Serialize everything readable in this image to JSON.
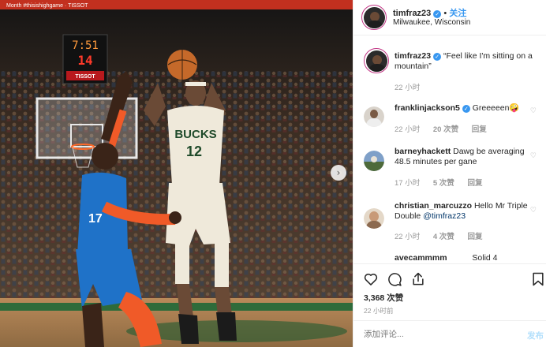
{
  "header": {
    "username": "timfraz23",
    "verified_icon": "verified-badge-icon",
    "separator": "•",
    "follow_label": "关注",
    "location": "Milwaukee, Wisconsin"
  },
  "photo": {
    "scoreboard_time": "7:51",
    "shot_clock": "14",
    "sponsor": "TISSOT",
    "jersey_team": "BUCKS",
    "jersey_number": "12",
    "opponent_number": "17",
    "banner_text": "Month  #thisishighgame  ·  TISSOT",
    "next_icon": "chevron-right-icon"
  },
  "caption": {
    "username": "timfraz23",
    "text": "“Feel like I'm sitting on a mountain”",
    "time": "22 小时"
  },
  "comments": [
    {
      "username": "franklinjackson5",
      "verified": true,
      "text": "Greeeeen🤪",
      "time": "22 小时",
      "likes": "20 次赞",
      "reply": "回复"
    },
    {
      "username": "barneyhackett",
      "verified": false,
      "text": "Dawg be averaging 48.5 minutes per gane",
      "time": "17 小时",
      "likes": "5 次赞",
      "reply": "回复"
    },
    {
      "username": "christian_marcuzzo",
      "verified": false,
      "text": "Hello Mr Triple Double ",
      "mention": "@timfraz23",
      "time": "22 小时",
      "likes": "4 次赞",
      "reply": "回复"
    },
    {
      "username": "avecammmm",
      "verified": false,
      "text": "Solid 4",
      "time": "",
      "likes": "",
      "reply": ""
    }
  ],
  "actions": {
    "like_icon": "heart-icon",
    "comment_icon": "comment-bubble-icon",
    "share_icon": "share-icon",
    "save_icon": "bookmark-icon",
    "likes_count": "3,368 次赞",
    "time_ago": "22 小时前"
  },
  "add_comment": {
    "placeholder": "添加评论...",
    "post_label": "发布"
  },
  "colors": {
    "accent": "#3897f0",
    "ring": "#c13584",
    "muted": "#999999",
    "border": "#efefef"
  }
}
